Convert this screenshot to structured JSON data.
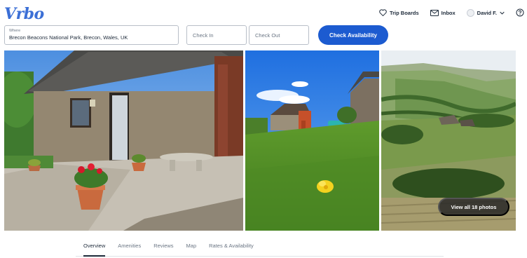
{
  "brand": {
    "logo_text": "Vrbo",
    "color": "#3b6fd6"
  },
  "topnav": {
    "trip_boards": "Trip Boards",
    "inbox": "Inbox",
    "user": "David F."
  },
  "search": {
    "where_label": "Where",
    "where_value": "Brecon Beacons National Park, Brecon, Wales, UK",
    "check_in_placeholder": "Check In",
    "check_out_placeholder": "Check Out",
    "submit_label": "Check Availability",
    "accent": "#1c5bd0"
  },
  "gallery": {
    "view_all_label": "View all 18 photos",
    "photos": [
      {
        "subject": "stone cottage with gravel yard and flower pots"
      },
      {
        "subject": "grass lawn with yellow buttercup and barn"
      },
      {
        "subject": "green valley landscape with hills"
      }
    ]
  },
  "tabs": [
    "Overview",
    "Amenities",
    "Reviews",
    "Map",
    "Rates & Availability"
  ],
  "active_tab": "Overview"
}
